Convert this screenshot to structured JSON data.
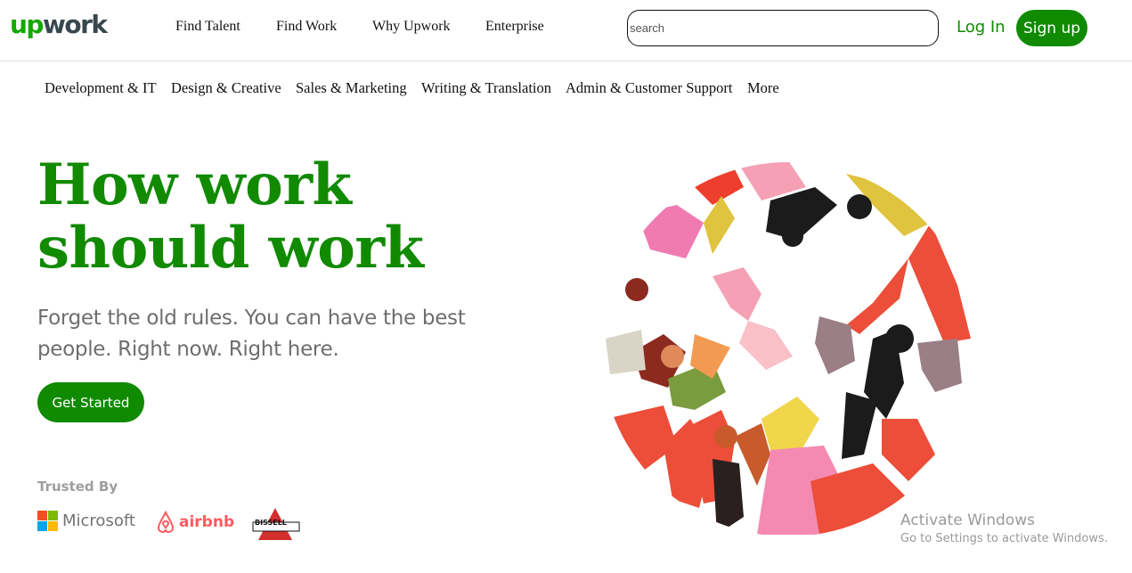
{
  "header": {
    "logo_accent": "up",
    "logo_rest": "work",
    "nav": [
      "Find Talent",
      "Find Work",
      "Why Upwork",
      "Enterprise"
    ],
    "search_placeholder": "search",
    "login_label": "Log In",
    "signup_label": "Sign up"
  },
  "categories": [
    "Development & IT",
    "Design & Creative",
    "Sales & Marketing",
    "Writing & Translation",
    "Admin & Customer Support",
    "More"
  ],
  "hero": {
    "title_line1": "How work",
    "title_line2": "should work",
    "subtitle_line1": "Forget the old rules. You can have the best",
    "subtitle_line2": "people. Right now. Right here.",
    "cta_label": "Get Started"
  },
  "trusted": {
    "label": "Trusted By",
    "brands": [
      "Microsoft",
      "airbnb",
      "BISSELL"
    ]
  },
  "watermark": {
    "line1": "Activate Windows",
    "line2": "Go to Settings to activate Windows."
  },
  "colors": {
    "brand_green": "#108a00",
    "title_green": "#118a00",
    "subtitle_gray": "#6e6e6e",
    "airbnb_red": "#ff5a5f"
  },
  "icons": [
    "microsoft-logo-icon",
    "airbnb-logo-icon",
    "bissell-logo-icon",
    "hero-illustration"
  ]
}
